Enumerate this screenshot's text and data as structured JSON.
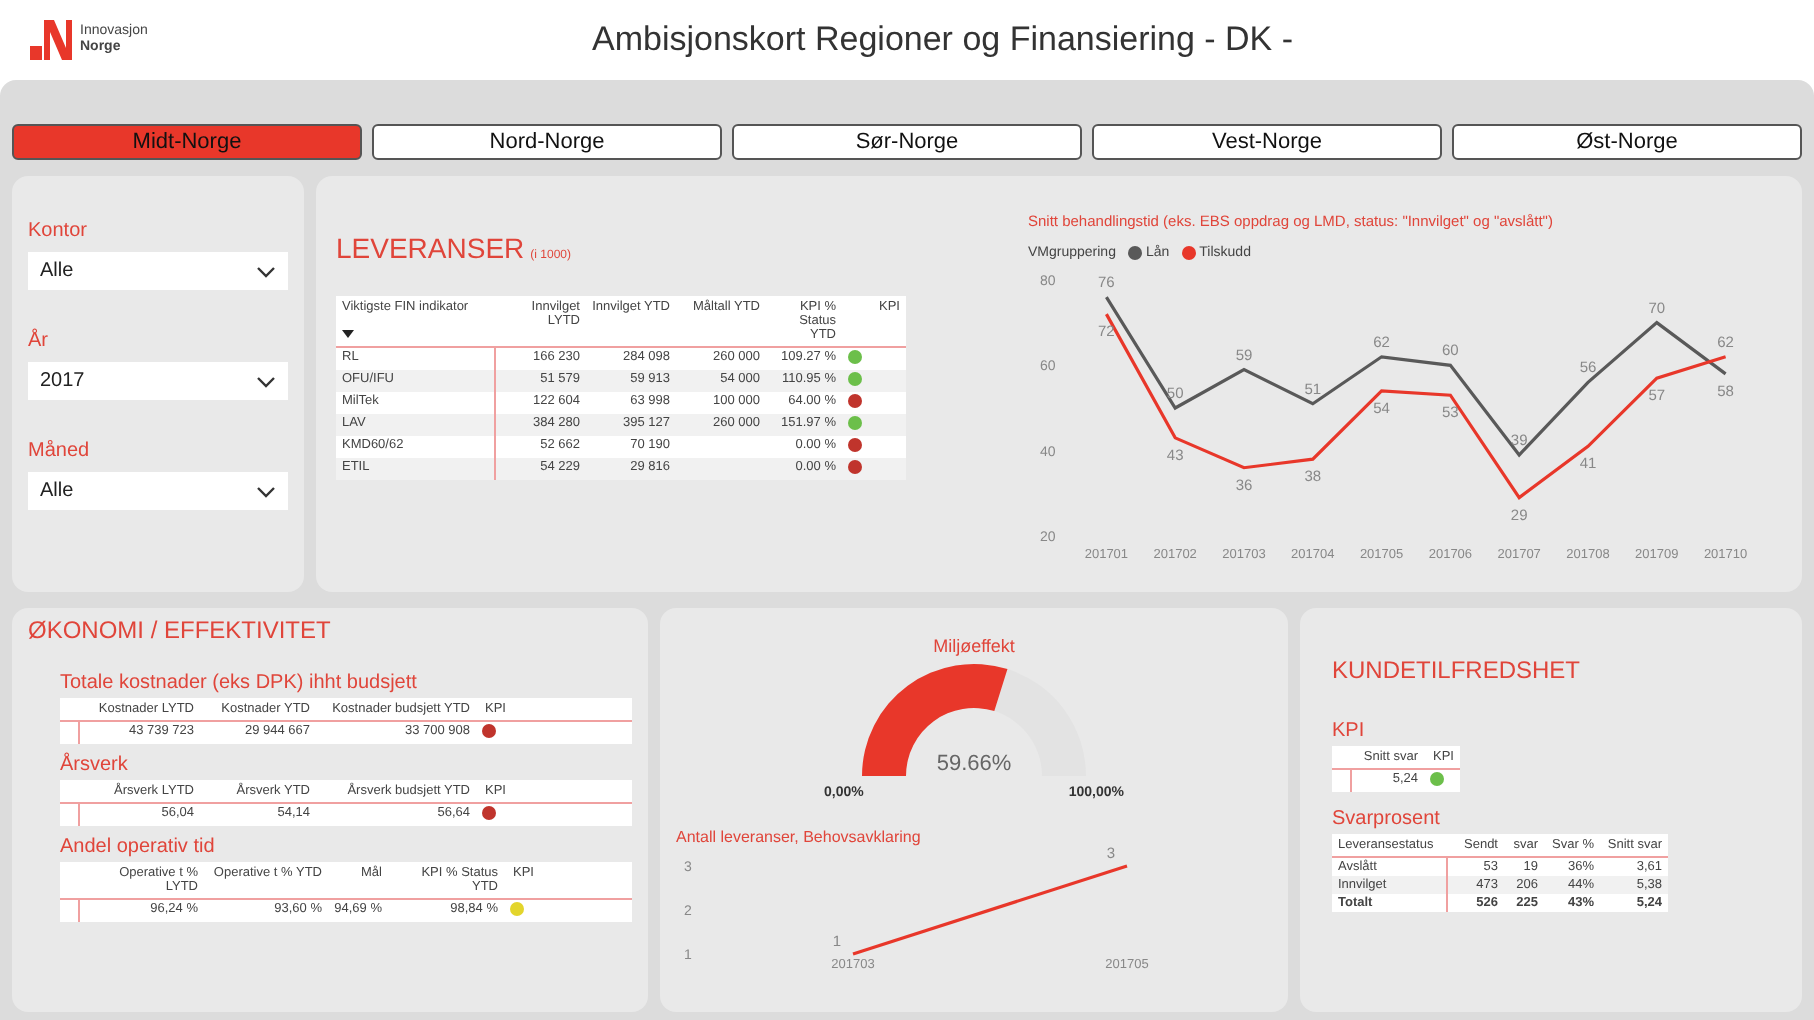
{
  "header": {
    "logo_text": [
      "Innovasjon",
      "Norge"
    ],
    "title": "Ambisjonskort Regioner og Finansiering - DK -"
  },
  "tabs": [
    {
      "label": "Midt-Norge",
      "selected": true
    },
    {
      "label": "Nord-Norge",
      "selected": false
    },
    {
      "label": "Sør-Norge",
      "selected": false
    },
    {
      "label": "Vest-Norge",
      "selected": false
    },
    {
      "label": "Øst-Norge",
      "selected": false
    }
  ],
  "filters": [
    {
      "label": "Kontor",
      "value": "Alle"
    },
    {
      "label": "År",
      "value": "2017"
    },
    {
      "label": "Måned",
      "value": "Alle"
    }
  ],
  "leveranser": {
    "title": "LEVERANSER",
    "unit": "(i 1000)",
    "columns": [
      "Viktigste FIN indikator",
      "Innvilget LYTD",
      "Innvilget YTD",
      "Måltall YTD",
      "KPI % Status YTD",
      "KPI"
    ],
    "rows": [
      {
        "cells": [
          "RL",
          "166 230",
          "284 098",
          "260 000",
          "109.27 %"
        ],
        "color": "#6cbf4a"
      },
      {
        "cells": [
          "OFU/IFU",
          "51 579",
          "59 913",
          "54 000",
          "110.95 %"
        ],
        "color": "#6cbf4a"
      },
      {
        "cells": [
          "MilTek",
          "122 604",
          "63 998",
          "100 000",
          "64.00 %"
        ],
        "color": "#c0342c"
      },
      {
        "cells": [
          "LAV",
          "384 280",
          "395 127",
          "260 000",
          "151.97 %"
        ],
        "color": "#6cbf4a"
      },
      {
        "cells": [
          "KMD60/62",
          "52 662",
          "70 190",
          null,
          "0.00 %"
        ],
        "color": "#c0342c"
      },
      {
        "cells": [
          "ETIL",
          "54 229",
          "29 816",
          null,
          "0.00 %"
        ],
        "color": "#c0342c"
      }
    ]
  },
  "behandlingstid": {
    "title": "Snitt behandlingstid (eks. EBS oppdrag og LMD, status: \"Innvilget\" og \"avslått\")",
    "legend_title": "VMgruppering",
    "chart_data": {
      "type": "line",
      "categories": [
        "201701",
        "201702",
        "201703",
        "201704",
        "201705",
        "201706",
        "201707",
        "201708",
        "201709",
        "201710"
      ],
      "series": [
        {
          "name": "Lån",
          "color": "#595959",
          "values": [
            76,
            50,
            59,
            51,
            62,
            60,
            39,
            56,
            70,
            58
          ]
        },
        {
          "name": "Tilskudd",
          "color": "#e8372a",
          "values": [
            72,
            43,
            36,
            38,
            54,
            53,
            29,
            41,
            57,
            62
          ]
        }
      ],
      "ylim": [
        20,
        80
      ],
      "yticks": [
        20,
        40,
        60,
        80
      ],
      "data_labels": true
    }
  },
  "okonomi": {
    "title": "ØKONOMI / EFFEKTIVITET",
    "tables": [
      {
        "title": "Totale kostnader (eks DPK) ihht budsjett",
        "columns": [
          "Kostnader LYTD",
          "Kostnader YTD",
          "Kostnader budsjett YTD",
          "KPI"
        ],
        "rows": [
          {
            "cells": [
              "43 739 723",
              "29 944 667",
              "33 700 908"
            ],
            "color": "#c0342c"
          }
        ]
      },
      {
        "title": "Årsverk",
        "columns": [
          "Årsverk LYTD",
          "Årsverk YTD",
          "Årsverk budsjett YTD",
          "KPI"
        ],
        "rows": [
          {
            "cells": [
              "56,04",
              "54,14",
              "56,64"
            ],
            "color": "#c0342c"
          }
        ]
      },
      {
        "title": "Andel operativ tid",
        "columns": [
          "Operative t % LYTD",
          "Operative t % YTD",
          "Mål",
          "KPI % Status YTD",
          "KPI"
        ],
        "rows": [
          {
            "cells": [
              "96,24 %",
              "93,60 %",
              "94,69 %",
              "98,84 %"
            ],
            "color": "#e3d52c"
          }
        ]
      }
    ]
  },
  "miljoeffekt": {
    "title": "Miljøeffekt",
    "level": 0.5966,
    "reading": "59.66%",
    "min": "0,00%",
    "max": "100,00%"
  },
  "antall": {
    "title": "Antall leveranser, Behovsavklaring",
    "chart_data": {
      "type": "line",
      "categories": [
        "201703",
        "201705"
      ],
      "series": [
        {
          "color": "#e8372a",
          "values": [
            1,
            3
          ]
        }
      ],
      "ylim": [
        1,
        3
      ],
      "yticks": [
        1,
        2,
        3
      ],
      "data_labels": true
    }
  },
  "kundetilfredshet": {
    "title": "KUNDETILFREDSHET",
    "kpi": {
      "title": "KPI",
      "columns": [
        "Snitt svar",
        "KPI"
      ],
      "rows": [
        {
          "cells": [
            "5,24"
          ],
          "color": "#6cbf4a"
        }
      ]
    },
    "svarprosent": {
      "title": "Svarprosent",
      "columns": [
        "Leveransestatus",
        "Sendt",
        "svar",
        "Svar %",
        "Snitt svar"
      ],
      "rows": [
        {
          "cells": [
            "Avslått",
            "53",
            "19",
            "36%",
            "3,61"
          ],
          "total": false
        },
        {
          "cells": [
            "Innvilget",
            "473",
            "206",
            "44%",
            "5,38"
          ],
          "total": false
        },
        {
          "cells": [
            "Totalt",
            "526",
            "225",
            "43%",
            "5,24"
          ],
          "total": true
        }
      ]
    }
  }
}
